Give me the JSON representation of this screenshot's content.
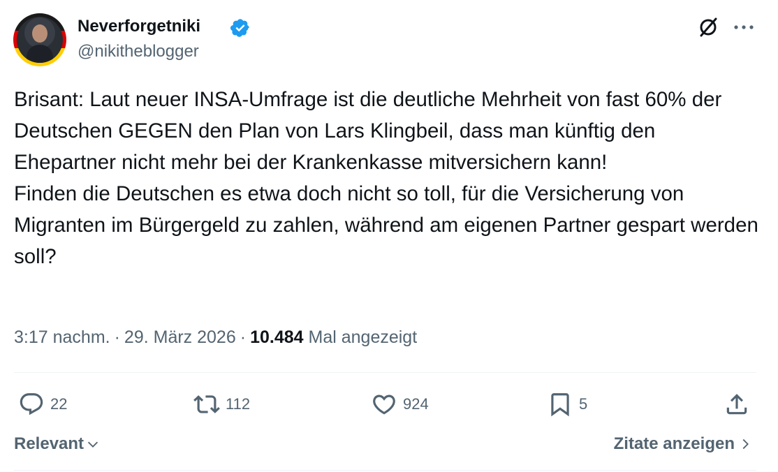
{
  "author": {
    "display_name": "Neverforgetniki",
    "handle": "@nikitheblogger",
    "verified": true
  },
  "icons": {
    "grok": "grok-icon",
    "more": "more-icon",
    "reply": "reply-icon",
    "retweet": "retweet-icon",
    "like": "like-icon",
    "bookmark": "bookmark-icon",
    "share": "share-icon"
  },
  "tweet": {
    "paragraph_1": "Brisant: Laut neuer INSA-Umfrage ist die deutliche Mehrheit von fast 60% der Deutschen GEGEN den Plan von Lars Klingbeil, dass man künftig den Ehepartner nicht mehr bei der Krankenkasse mitversichern kann!",
    "paragraph_2": "Finden die Deutschen es etwa doch nicht so toll, für die Versicherung von Migranten im Bürgergeld zu zahlen, während am eigenen Partner gespart werden soll?"
  },
  "meta": {
    "time": "3:17 nachm.",
    "date": "29. März 2026",
    "separator": "·",
    "views_count": "10.484",
    "views_label": "Mal angezeigt"
  },
  "actions": {
    "replies": "22",
    "reposts": "112",
    "likes": "924",
    "bookmarks": "5"
  },
  "footer": {
    "sort_label": "Relevant",
    "quotes_label": "Zitate anzeigen"
  },
  "colors": {
    "text": "#0f1419",
    "secondary": "#536471",
    "verified": "#1d9bf0",
    "divider": "#eff3f4"
  }
}
